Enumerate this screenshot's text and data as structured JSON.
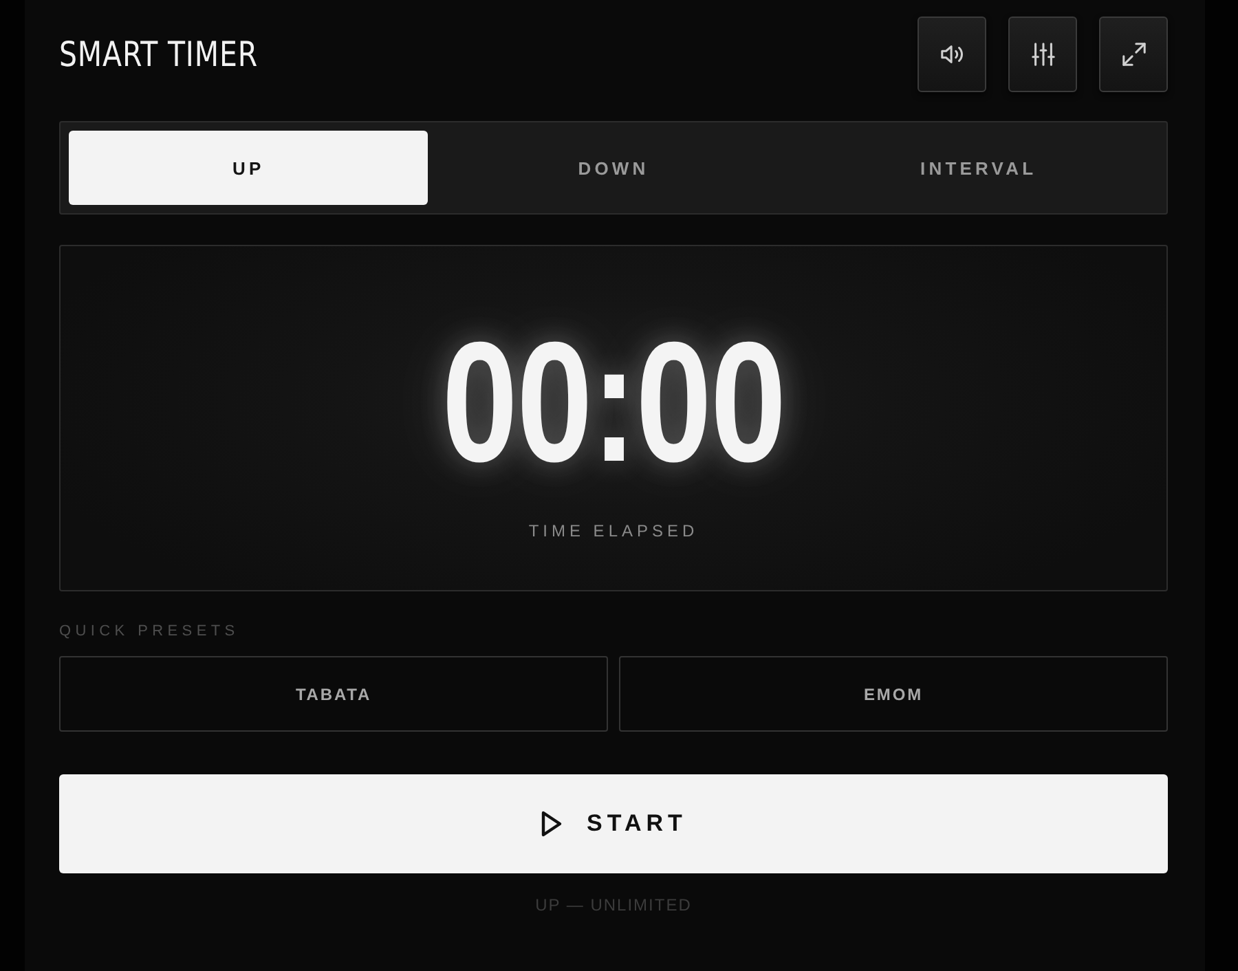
{
  "header": {
    "title": "SMART TIMER",
    "tools": [
      {
        "kind": "sound"
      },
      {
        "kind": "sliders"
      },
      {
        "kind": "expand"
      }
    ]
  },
  "modes": [
    {
      "label": "UP",
      "selected": true
    },
    {
      "label": "DOWN",
      "selected": false
    },
    {
      "label": "INTERVAL",
      "selected": false
    }
  ],
  "display": {
    "time": "00:00",
    "caption": "TIME ELAPSED"
  },
  "presets": {
    "heading": "QUICK PRESETS",
    "items": [
      "TABATA",
      "EMOM"
    ]
  },
  "start_button": {
    "label": "START"
  },
  "status": "UP — UNLIMITED"
}
